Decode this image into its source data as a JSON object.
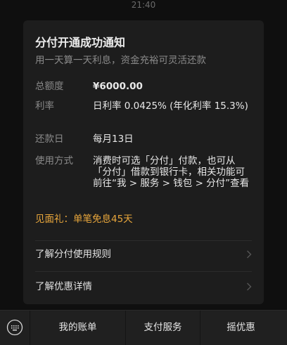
{
  "status_bar": {
    "time": "21:40"
  },
  "card": {
    "title": "分付开通成功通知",
    "subtitle": "用一天算一天利息，资金充裕可灵活还款",
    "rows": [
      {
        "label": "总额度",
        "value": "¥6000.00"
      },
      {
        "label": "利率",
        "value": "日利率 0.0425% (年化利率 15.3%)"
      },
      {
        "label": "还款日",
        "value": "每月13日"
      },
      {
        "label": "使用方式",
        "value": "消费时可选「分付」付款，也可从「分付」借款到银行卡，相关功能可前往“我 > 服务 > 钱包 > 分付”查看"
      }
    ],
    "gift": "见面礼：单笔免息45天",
    "links": [
      {
        "label": "了解分付使用规则",
        "icon": "chevron-right-icon"
      },
      {
        "label": "了解优惠详情",
        "icon": "chevron-right-icon"
      }
    ]
  },
  "bottom_bar": {
    "keyboard_icon": "keyboard-icon",
    "tabs": [
      "我的账单",
      "支付服务",
      "摇优惠"
    ]
  }
}
